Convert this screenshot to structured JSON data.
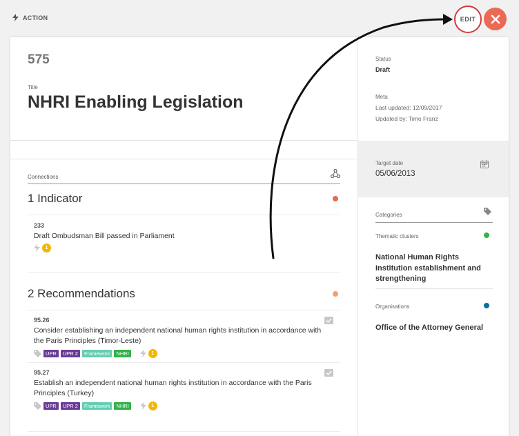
{
  "header": {
    "action_label": "ACTION",
    "edit_label": "EDIT"
  },
  "item": {
    "number": "575",
    "title_label": "Title",
    "title": "NHRI Enabling Legislation"
  },
  "status": {
    "label": "Status",
    "value": "Draft"
  },
  "meta": {
    "label": "Meta",
    "last_updated": "Last updated: 12/09/2017",
    "updated_by": "Updated by: Timo Franz"
  },
  "target": {
    "label": "Target date",
    "value": "05/06/2013"
  },
  "connections": {
    "label": "Connections",
    "indicator_title": "1 Indicator",
    "indicator_color": "#e36a4f",
    "indicators": [
      {
        "num": "233",
        "text": "Draft Ombudsman Bill passed in Parliament",
        "badge": "1"
      }
    ],
    "recommendations_title": "2 Recommendations",
    "recommendations_color": "#f3a068",
    "recommendations": [
      {
        "num": "95.26",
        "text": "Consider establishing an independent national human rights institution in accordance with the Paris Principles (Timor-Leste)",
        "tags": [
          "UPR",
          "UPR 2",
          "Framework",
          "NHRI"
        ],
        "badge": "1"
      },
      {
        "num": "95.27",
        "text": "Establish an independent national human rights institution in accordance with the Paris Principles (Turkey)",
        "tags": [
          "UPR",
          "UPR 2",
          "Framework",
          "NHRI"
        ],
        "badge": "1"
      }
    ]
  },
  "categories": {
    "label": "Categories",
    "thematic_label": "Thematic clusters",
    "thematic_color": "#3bb04a",
    "thematic_value": "National Human Rights Institution establishment and strengthening",
    "org_label": "Organisations",
    "org_color": "#0b6f9c",
    "org_value": "Office of the Attorney General"
  },
  "colors": {
    "close_button": "#ec6a54",
    "edit_ring": "#d23a3a"
  }
}
